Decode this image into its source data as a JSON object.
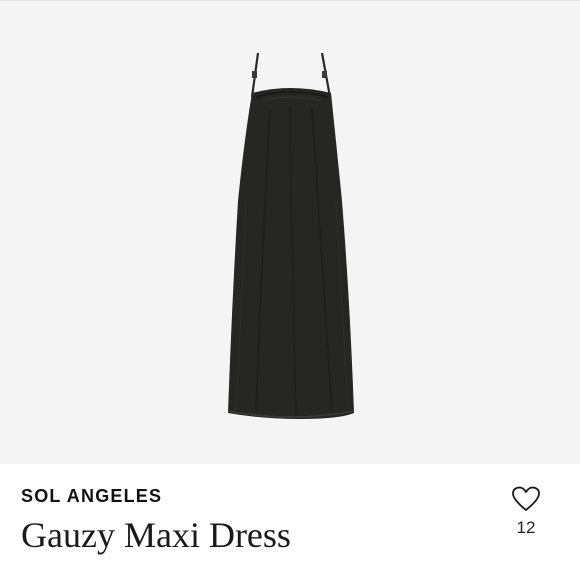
{
  "product": {
    "brand": "SOL ANGELES",
    "name": "Gauzy Maxi Dress",
    "favorites_count": "12",
    "favorite_icon": "heart-outline-icon",
    "image_subject": "black sleeveless maxi slip dress with thin straps"
  },
  "colors": {
    "image_background": "#f4f4f4",
    "dress": "#262624",
    "text": "#111111"
  }
}
